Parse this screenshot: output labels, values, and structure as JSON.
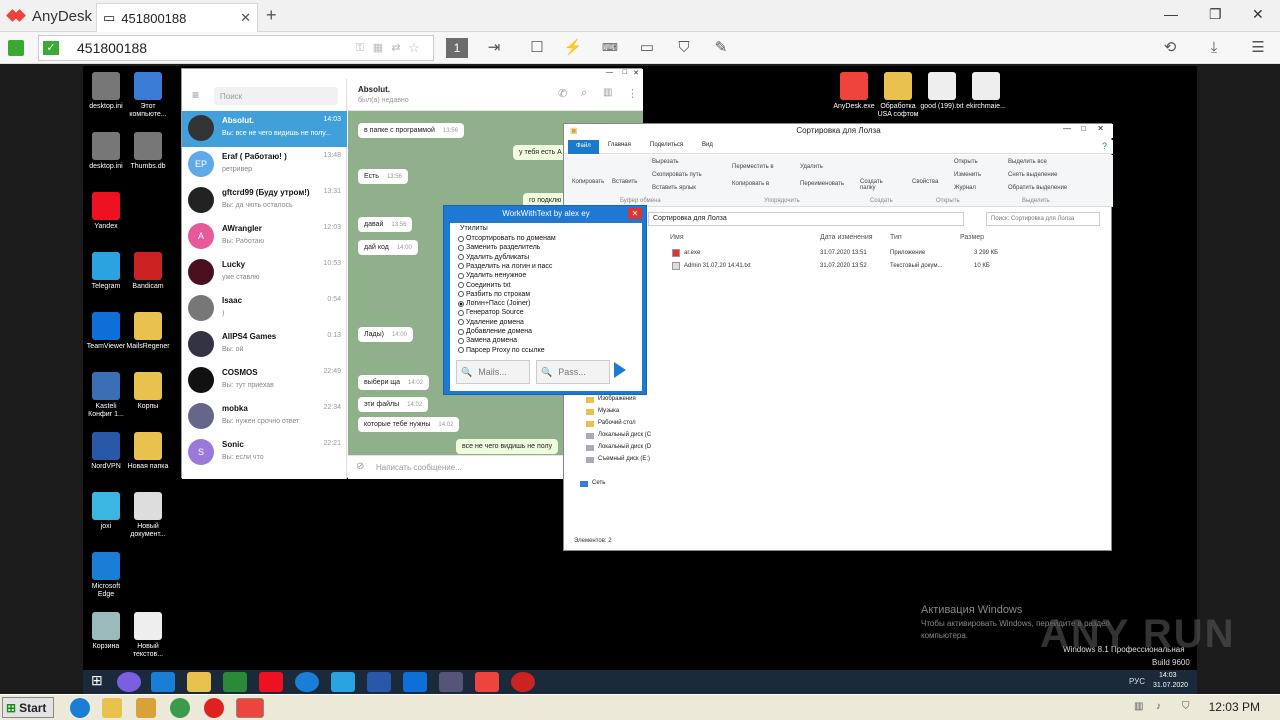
{
  "app": {
    "name": "AnyDesk",
    "tab_title": "451800188"
  },
  "toolbar": {
    "address": "451800188",
    "display_num": "1"
  },
  "desktop_left": [
    {
      "label": "desktop.ini",
      "color": "#777"
    },
    {
      "label": "Этот компьюте...",
      "color": "#3a7bd5"
    },
    {
      "label": "desktop.ini",
      "color": "#777"
    },
    {
      "label": "Thumbs.db",
      "color": "#777"
    },
    {
      "label": "Yandex",
      "color": "#e12"
    },
    {
      "label": "Telegram",
      "color": "#2aa3e0"
    },
    {
      "label": "Bandicam",
      "color": "#c22"
    },
    {
      "label": "TeamViewer",
      "color": "#0e6fd8"
    },
    {
      "label": "MailsRegener",
      "color": "#e8c14e"
    },
    {
      "label": "Kasteli Конфиг 1...",
      "color": "#3b6fb5"
    },
    {
      "label": "Корпы",
      "color": "#e8c14e"
    },
    {
      "label": "NordVPN",
      "color": "#2a58a8"
    },
    {
      "label": "Новая папка",
      "color": "#e8c14e"
    },
    {
      "label": "joxi",
      "color": "#3bb6e0"
    },
    {
      "label": "Новый документ...",
      "color": "#ddd"
    },
    {
      "label": "Microsoft Edge",
      "color": "#1a7ed6"
    },
    {
      "label": "Корзина",
      "color": "#9bb"
    },
    {
      "label": "Новый текстов...",
      "color": "#eee"
    }
  ],
  "desktop_right": [
    {
      "label": "AnyDesk.exe",
      "color": "#ef443b"
    },
    {
      "label": "Обработка USA софтом",
      "color": "#e8c14e"
    },
    {
      "label": "good (199).txt",
      "color": "#eee"
    },
    {
      "label": "ekirchmaie...",
      "color": "#eee"
    }
  ],
  "telegram": {
    "search_placeholder": "Поиск",
    "chat_title": "Absolut.",
    "chat_status": "был(а) недавно",
    "input_placeholder": "Написать сообщение...",
    "chats": [
      {
        "name": "Absolut.",
        "time": "14:03",
        "msg": "Вы: все не чего видишь не полу...",
        "color": "#333",
        "initials": ""
      },
      {
        "name": "Eraf ( Работаю! )",
        "time": "13:48",
        "msg": "ретривер",
        "color": "#5eaae6",
        "initials": "EP"
      },
      {
        "name": "gftcrd99 (Буду утром!)",
        "time": "13:31",
        "msg": "Вы: да чють осталось",
        "color": "#222",
        "initials": ""
      },
      {
        "name": "AWrangler",
        "time": "12:03",
        "msg": "Вы: Работаю",
        "color": "#e7599b",
        "initials": "A"
      },
      {
        "name": "Lucky",
        "time": "10:53",
        "msg": "уже ставлю",
        "color": "#4a1020",
        "initials": ""
      },
      {
        "name": "Isaac",
        "time": "0:54",
        "msg": ")",
        "color": "#777",
        "initials": ""
      },
      {
        "name": "AllPS4 Games",
        "time": "0:13",
        "msg": "Вы: ой",
        "color": "#334",
        "initials": ""
      },
      {
        "name": "COSMOS",
        "time": "22:49",
        "msg": "Вы: тут приехав",
        "color": "#111",
        "initials": ""
      },
      {
        "name": "mobka",
        "time": "22:34",
        "msg": "Вы: нужен срочно ответ",
        "color": "#668",
        "initials": ""
      },
      {
        "name": "Sonic",
        "time": "22:21",
        "msg": "Вы: если что",
        "color": "#9a79d8",
        "initials": "S"
      }
    ],
    "messages": [
      {
        "text": "в папке с программой",
        "time": "13:56",
        "out": false
      },
      {
        "text": "у тебя есть А",
        "time": "",
        "out": true
      },
      {
        "text": "Есть",
        "time": "13:56",
        "out": false
      },
      {
        "text": "го подклю",
        "time": "",
        "out": true
      },
      {
        "text": "давай",
        "time": "13:56",
        "out": false
      },
      {
        "text": "дай код",
        "time": "14:00",
        "out": false
      },
      {
        "text": "Лады)",
        "time": "14:00",
        "out": false
      },
      {
        "text": "выбери ща",
        "time": "14:02",
        "out": false
      },
      {
        "text": "эти файлы",
        "time": "14:02",
        "out": false
      },
      {
        "text": "которые тебе нужны",
        "time": "14:02",
        "out": false
      },
      {
        "text": "все не чего видишь не полу",
        "time": "",
        "out": true
      }
    ]
  },
  "wwt": {
    "title": "WorkWithText by alex ey",
    "group": "Утилиты",
    "options": [
      "Отсортировать по доменам",
      "Заменить разделитель",
      "Удалить дубликаты",
      "Разделить на логин и пасс",
      "Удалить ненужное",
      "Соединить txt",
      "Разбить по строкам",
      "Логин+Пасс (Joiner)",
      "Генератор Source",
      "Удаление домена",
      "Добавление домена",
      "Замена домена",
      "Парсер Proxy по ссылке"
    ],
    "mails_btn": "Mails...",
    "pass_btn": "Pass..."
  },
  "explorer": {
    "title": "Сортировка для Лолза",
    "tabs": [
      "Файл",
      "Главная",
      "Поделиться",
      "Вид"
    ],
    "ribbon": {
      "copy": "Копировать",
      "paste": "Вставить",
      "cut": "Вырезать",
      "copy_path": "Скопировать путь",
      "paste_link": "Вставить ярлык",
      "move_to": "Переместить в",
      "copy_to": "Копировать в",
      "delete": "Удалить",
      "rename": "Переименовать",
      "new_folder": "Создать папку",
      "properties": "Свойства",
      "open": "Открыть",
      "edit": "Изменить",
      "journal": "Журнал",
      "select_all": "Выделить все",
      "select_none": "Снять выделение",
      "invert": "Обратить выделение",
      "groups": [
        "Буфер обмена",
        "Упорядочить",
        "Создать",
        "Открыть",
        "Выделить"
      ]
    },
    "address": "Сортировка для Лолза",
    "search": "Поиск: Сортировка для Лолза",
    "columns": [
      "Имя",
      "Дата изменения",
      "Тип",
      "Размер"
    ],
    "files": [
      {
        "name": "ar.exe",
        "date": "31.07.2020 13:51",
        "type": "Приложение",
        "size": "3 299 КБ"
      },
      {
        "name": "Admin 31.07.20 14:41.txt",
        "date": "31.07.2020 13:52",
        "type": "Текстовый докум...",
        "size": "10 КБ"
      }
    ],
    "nav": [
      "Изображения",
      "Музыка",
      "Рабочий стол",
      "Локальный диск (C",
      "Локальный диск (D",
      "Съемный диск (E:)",
      "Сеть"
    ],
    "status": "Элементов: 2"
  },
  "activation": {
    "line1": "Активация Windows",
    "line2": "Чтобы активировать Windows, перейдите в раздел",
    "line3": "компьютера.",
    "os": "Windows 8.1 Профессиональная",
    "build": "Build 9600"
  },
  "inner_clock": {
    "time": "14:03",
    "date": "31.07.2020",
    "lang": "РУС"
  },
  "host_taskbar": {
    "start": "Start",
    "clock": "12:03 PM"
  },
  "watermark": "ANY RUN"
}
